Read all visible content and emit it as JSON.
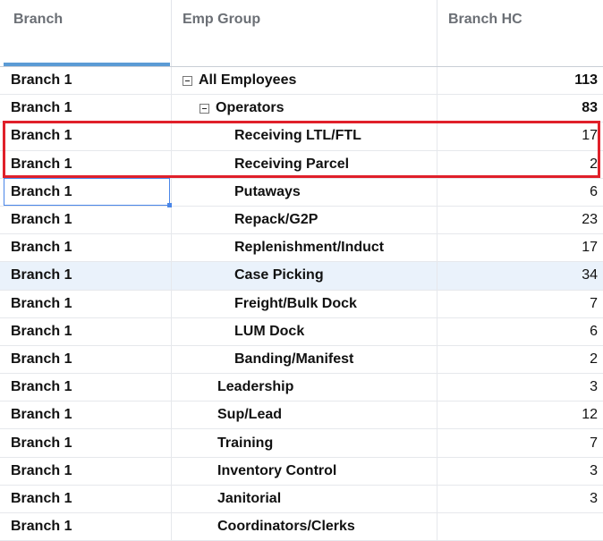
{
  "headers": {
    "branch": "Branch",
    "emp_group": "Emp Group",
    "branch_hc": "Branch HC"
  },
  "rows": [
    {
      "branch": "Branch 1",
      "group": "All Employees",
      "hc": "113"
    },
    {
      "branch": "Branch 1",
      "group": "Operators",
      "hc": "83"
    },
    {
      "branch": "Branch 1",
      "group": "Receiving LTL/FTL",
      "hc": "17"
    },
    {
      "branch": "Branch 1",
      "group": "Receiving Parcel",
      "hc": "2"
    },
    {
      "branch": "Branch 1",
      "group": "Putaways",
      "hc": "6"
    },
    {
      "branch": "Branch 1",
      "group": "Repack/G2P",
      "hc": "23"
    },
    {
      "branch": "Branch 1",
      "group": "Replenishment/Induct",
      "hc": "17"
    },
    {
      "branch": "Branch 1",
      "group": "Case Picking",
      "hc": "34"
    },
    {
      "branch": "Branch 1",
      "group": "Freight/Bulk Dock",
      "hc": "7"
    },
    {
      "branch": "Branch 1",
      "group": "LUM Dock",
      "hc": "6"
    },
    {
      "branch": "Branch 1",
      "group": "Banding/Manifest",
      "hc": "2"
    },
    {
      "branch": "Branch 1",
      "group": "Leadership",
      "hc": "3"
    },
    {
      "branch": "Branch 1",
      "group": "Sup/Lead",
      "hc": "12"
    },
    {
      "branch": "Branch 1",
      "group": "Training",
      "hc": "7"
    },
    {
      "branch": "Branch 1",
      "group": "Inventory Control",
      "hc": "3"
    },
    {
      "branch": "Branch 1",
      "group": "Janitorial",
      "hc": "3"
    },
    {
      "branch": "Branch 1",
      "group": "Coordinators/Clerks",
      "hc": ""
    }
  ],
  "colors": {
    "highlight": "#e0202a",
    "selection": "#4a86e8",
    "hover_row": "#eaf2fb",
    "sort_indicator": "#5b9bd5"
  }
}
